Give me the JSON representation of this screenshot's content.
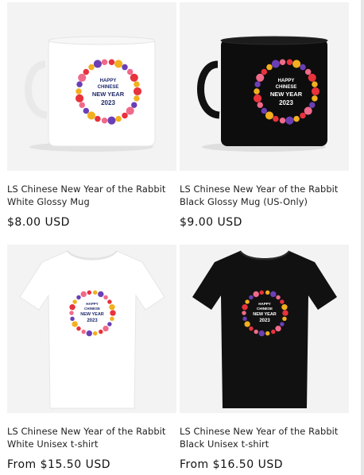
{
  "products": [
    {
      "title_line1": "LS Chinese New Year of the Rabbit",
      "title_line2": "White Glossy Mug",
      "price": "$8.00 USD",
      "image": "white-glossy-mug",
      "image_text": [
        "HAPPY",
        "CHINESE",
        "NEW YEAR",
        "2023"
      ]
    },
    {
      "title_line1": "LS Chinese New Year of the Rabbit",
      "title_line2": "Black Glossy Mug (US-Only)",
      "price": "$9.00 USD",
      "image": "black-glossy-mug",
      "image_text": [
        "HAPPY",
        "CHINESE",
        "NEW YEAR",
        "2023"
      ]
    },
    {
      "title_line1": "LS Chinese New Year of the Rabbit",
      "title_line2": "White Unisex t-shirt",
      "price": "From $15.50 USD",
      "image": "white-tshirt",
      "image_text": [
        "HAPPY",
        "CHINESE",
        "NEW YEAR",
        "2023"
      ]
    },
    {
      "title_line1": "LS Chinese New Year of the Rabbit",
      "title_line2": "Black Unisex t-shirt",
      "price": "From $16.50 USD",
      "image": "black-tshirt",
      "image_text": [
        "HAPPY",
        "CHINESE",
        "NEW YEAR",
        "2023"
      ]
    }
  ],
  "colors": {
    "wreath_red": "#e8323c",
    "wreath_gold": "#f2b01e",
    "wreath_purple": "#6a3fb5",
    "wreath_pink": "#f06a8a",
    "text_navy": "#1f2a6b"
  }
}
